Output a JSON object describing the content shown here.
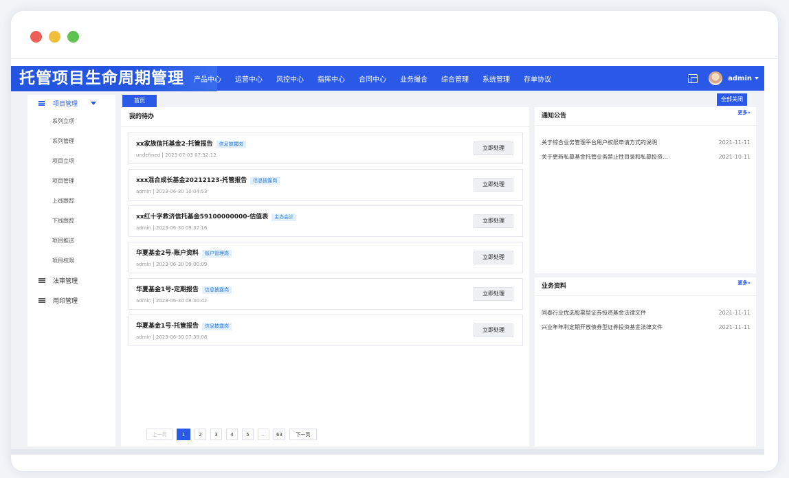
{
  "window": {
    "dots": [
      "#ec5f57",
      "#f1be3c",
      "#5ec353"
    ]
  },
  "header": {
    "brand": "托管项目生命周期管理",
    "nav": [
      "产品中心",
      "运营中心",
      "风控中心",
      "指挥中心",
      "合同中心",
      "业务撮合",
      "综合管理",
      "系统管理",
      "存单协议"
    ],
    "msg_count": "0",
    "user": "admin",
    "accent": "#2a59e7"
  },
  "sidebar": {
    "group1": "项目管理",
    "subs": [
      "系列立项",
      "系列管理",
      "项目立项",
      "项目管理",
      "上线跟踪",
      "下线跟踪",
      "项目推送",
      "项目权限"
    ],
    "group2": "法审管理",
    "group3": "用印管理"
  },
  "tabs": {
    "home": "首页",
    "close_all": "全部关闭"
  },
  "todo": {
    "title": "我的待办",
    "btn": "立即处理",
    "items": [
      {
        "title": "xx家族信托基金2-托管报告",
        "tag": "信息披露岗",
        "user": "undefined",
        "time": "2023-07-03 07:32:12"
      },
      {
        "title": "xxx混合成长基金20212123-托管报告",
        "tag": "信息披露岗",
        "user": "admin",
        "time": "2023-06-30 10:04:53"
      },
      {
        "title": "xx红十字救济信托基金59100000000-估值表",
        "tag": "主办会计",
        "user": "admin",
        "time": "2023-06-30 09:37:16"
      },
      {
        "title": "华夏基金2号-账户资料",
        "tag": "账户管理岗",
        "user": "admin",
        "time": "2023-06-30 09:00:09"
      },
      {
        "title": "华夏基金1号-定期报告",
        "tag": "信息披露岗",
        "user": "admin",
        "time": "2023-06-30 08:40:42"
      },
      {
        "title": "华夏基金1号-托管报告",
        "tag": "信息披露岗",
        "user": "admin",
        "time": "2023-06-30 07:39:08"
      }
    ]
  },
  "pager": {
    "prev": "上一页",
    "pages": [
      "1",
      "2",
      "3",
      "4",
      "5",
      "...",
      "63"
    ],
    "next": "下一页"
  },
  "notice": {
    "title": "通知公告",
    "more": "更多»",
    "items": [
      {
        "text": "关于综合业务管理平台用户权限申请方式的说明",
        "date": "2021-11-11"
      },
      {
        "text": "关于更新私募基金托管业务禁止性目录和私募投资…",
        "date": "2021-10-11"
      }
    ]
  },
  "docs": {
    "title": "业务资料",
    "more": "更多»",
    "items": [
      {
        "text": "同泰行业优选股票型证券投资基金法律文件",
        "date": "2021-11-11"
      },
      {
        "text": "兴业年年利定期开放债券型证券投资基金法律文件",
        "date": "2021-11-11"
      }
    ]
  }
}
